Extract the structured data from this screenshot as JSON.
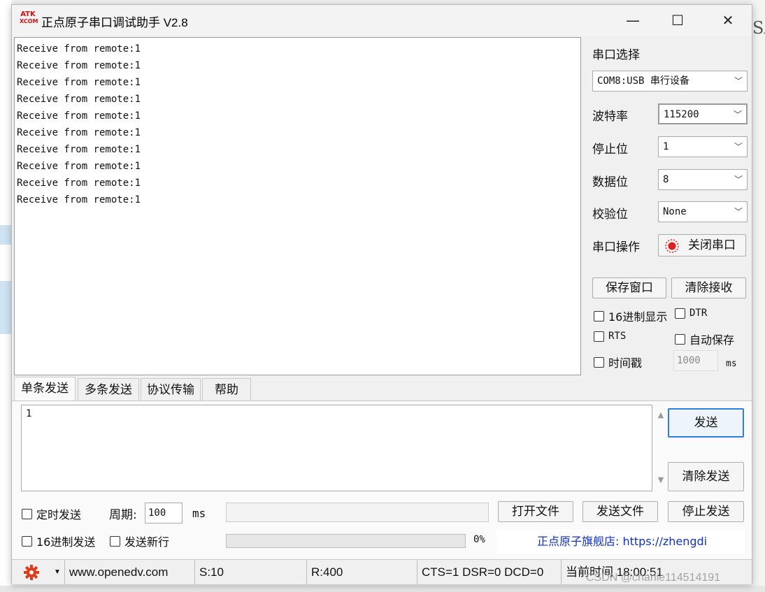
{
  "window": {
    "logo_top": "ATK",
    "logo_bottom": "XCOM",
    "title": "正点原子串口调试助手 V2.8",
    "minimize": "—",
    "maximize": "☐",
    "close": "✕"
  },
  "receive": {
    "lines": [
      "Receive from remote:1",
      "Receive from remote:1",
      "Receive from remote:1",
      "Receive from remote:1",
      "Receive from remote:1",
      "Receive from remote:1",
      "Receive from remote:1",
      "Receive from remote:1",
      "Receive from remote:1",
      "Receive from remote:1"
    ]
  },
  "port": {
    "section_label": "串口选择",
    "port_value": "COM8:USB 串行设备",
    "baud_label": "波特率",
    "baud_value": "115200",
    "stop_label": "停止位",
    "stop_value": "1",
    "data_label": "数据位",
    "data_value": "8",
    "parity_label": "校验位",
    "parity_value": "None",
    "op_label": "串口操作",
    "op_button": "关闭串口"
  },
  "receive_options": {
    "save_window": "保存窗口",
    "clear_receive": "清除接收",
    "hex_display": "16进制显示",
    "dtr": "DTR",
    "rts": "RTS",
    "auto_save": "自动保存",
    "timestamp": "时间戳",
    "timestamp_value": "1000",
    "timestamp_unit": "ms"
  },
  "tabs": [
    "单条发送",
    "多条发送",
    "协议传输",
    "帮助"
  ],
  "send": {
    "text": "1",
    "send_button": "发送",
    "clear_send_button": "清除发送",
    "timed_send": "定时发送",
    "period_label": "周期:",
    "period_value": "100",
    "period_unit": "ms",
    "open_file": "打开文件",
    "send_file": "发送文件",
    "stop_send": "停止发送",
    "hex_send": "16进制发送",
    "send_newline": "发送新行",
    "progress": "0%",
    "progress_value": 0,
    "store_link": "正点原子旗舰店: https://zhengdi"
  },
  "status": {
    "url": "www.openedv.com",
    "sent": "S:10",
    "received": "R:400",
    "lines": "CTS=1 DSR=0 DCD=0",
    "time": "当前时间 18:00:51"
  },
  "background": {
    "right_fragment": "SA",
    "watermark": "CSDN @charlie114514191"
  },
  "colors": {
    "accent": "#2c7ee0",
    "link": "#1030c8",
    "status_led": "#e02020"
  }
}
